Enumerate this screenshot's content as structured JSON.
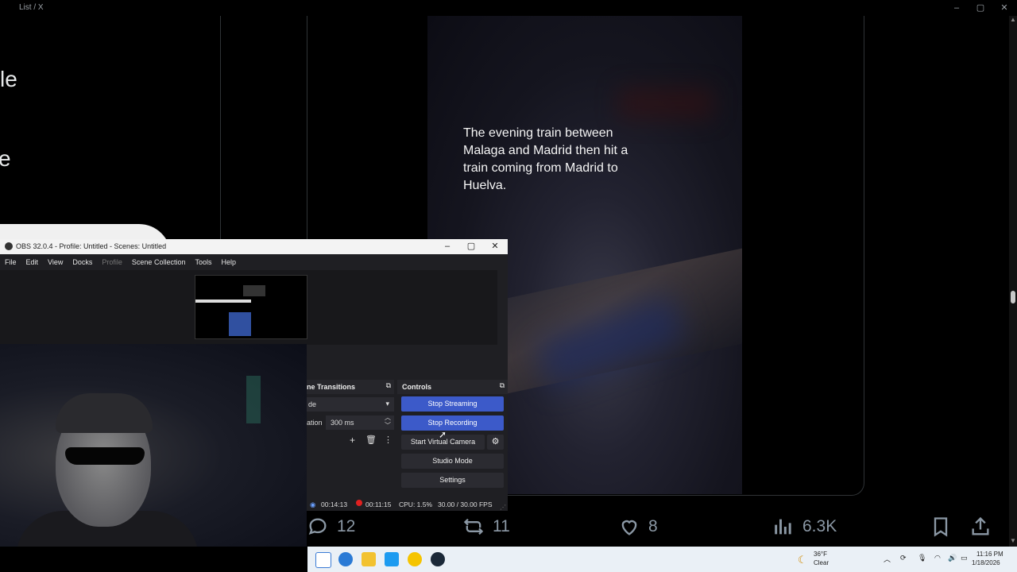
{
  "browser": {
    "tab_title": "List / X",
    "min": "–",
    "max": "▢",
    "close": "✕"
  },
  "side": {
    "text1": "le",
    "text2": "e"
  },
  "post": {
    "caption": "The evening train between Malaga and Madrid then hit a train coming from Madrid to Huelva.",
    "replies": "12",
    "reposts": "11",
    "likes": "8",
    "views": "6.3K"
  },
  "obs": {
    "title": "OBS 32.0.4 - Profile: Untitled - Scenes: Untitled",
    "menu": [
      "File",
      "Edit",
      "View",
      "Docks",
      "Profile",
      "Scene Collection",
      "Tools",
      "Help"
    ],
    "transitions": {
      "header": "ne Transitions",
      "transition_value": "de",
      "duration_label": "ation",
      "duration_value": "300 ms"
    },
    "controls": {
      "header": "Controls",
      "stop_streaming": "Stop Streaming",
      "stop_recording": "Stop Recording",
      "start_virtual_camera": "Start Virtual Camera",
      "studio_mode": "Studio Mode",
      "settings": "Settings"
    },
    "status": {
      "stream_time": "00:14:13",
      "record_time": "00:11:15",
      "cpu": "CPU: 1.5%",
      "fps": "30.00 / 30.00 FPS"
    },
    "colors": {
      "accent": "#3c5ac9",
      "record": "#e02020"
    }
  },
  "taskbar": {
    "weather_temp": "36°F",
    "weather_desc": "Clear",
    "time": "11:16 PM",
    "date": "1/18/2026"
  }
}
